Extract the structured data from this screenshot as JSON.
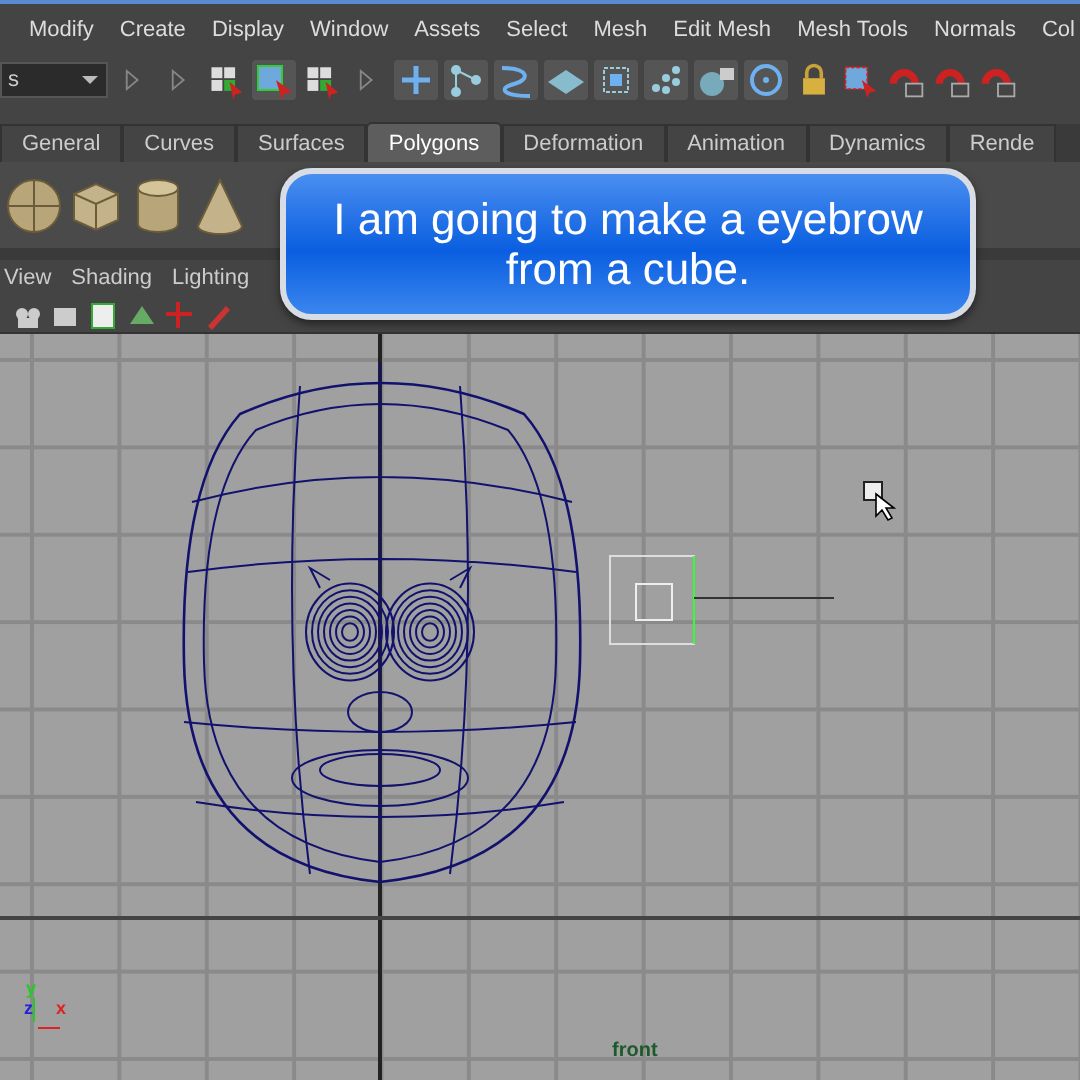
{
  "menu_bar": {
    "items": [
      "Modify",
      "Create",
      "Display",
      "Window",
      "Assets",
      "Select",
      "Mesh",
      "Edit Mesh",
      "Mesh Tools",
      "Normals",
      "Col"
    ]
  },
  "toolbar": {
    "mode_dropdown": "s"
  },
  "shelf": {
    "tabs": [
      {
        "label": "General",
        "selected": false
      },
      {
        "label": "Curves",
        "selected": false
      },
      {
        "label": "Surfaces",
        "selected": false
      },
      {
        "label": "Polygons",
        "selected": true
      },
      {
        "label": "Deformation",
        "selected": false
      },
      {
        "label": "Animation",
        "selected": false
      },
      {
        "label": "Dynamics",
        "selected": false
      },
      {
        "label": "Rende",
        "selected": false
      }
    ]
  },
  "panel_menu": {
    "items": [
      "View",
      "Shading",
      "Lighting"
    ]
  },
  "viewport": {
    "camera": "front",
    "axis_labels": [
      "y",
      "z",
      "x"
    ]
  },
  "callout": {
    "text": "I am going to make a eyebrow from a cube."
  }
}
